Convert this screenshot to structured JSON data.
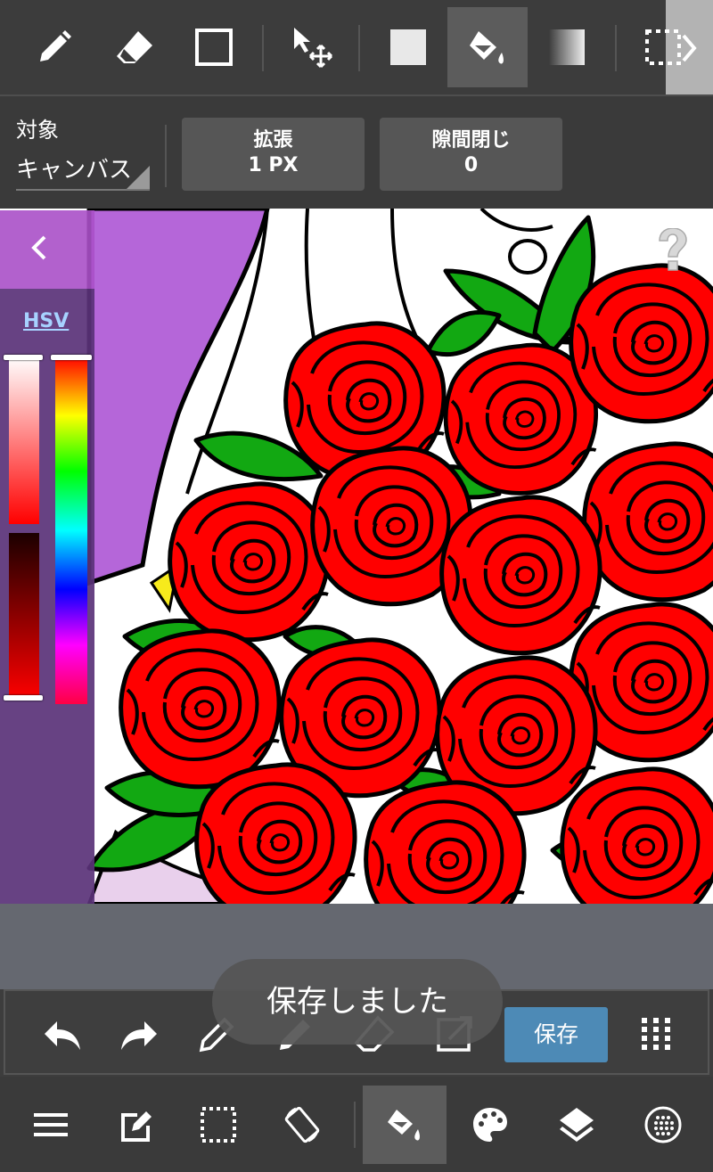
{
  "toolbar": {
    "tools": [
      {
        "name": "pen",
        "icon": "pencil-icon"
      },
      {
        "name": "eraser",
        "icon": "eraser-icon"
      },
      {
        "name": "shape",
        "icon": "square-outline-icon"
      },
      {
        "name": "move",
        "icon": "move-arrows-icon"
      },
      {
        "name": "fill-color",
        "icon": "filled-square-icon"
      },
      {
        "name": "bucket",
        "icon": "paint-bucket-icon",
        "selected": true
      },
      {
        "name": "gradient",
        "icon": "gradient-icon"
      },
      {
        "name": "select",
        "icon": "dashed-select-icon"
      }
    ],
    "more_icon": "chevron-right-icon"
  },
  "fill_options": {
    "target_label": "対象",
    "target_value": "キャンバス",
    "expand_label": "拡張",
    "expand_value": "1 PX",
    "gap_close_label": "隙間閉じ",
    "gap_close_value": "0"
  },
  "color_panel": {
    "mode_label": "HSV",
    "current_color": "#ff0000"
  },
  "action_bar": {
    "save_label": "保存",
    "icons": [
      "undo-icon",
      "redo-icon",
      "pencil-icon",
      "pen-icon",
      "eraser-icon",
      "transform-icon",
      "grid-dots-icon"
    ]
  },
  "toast": {
    "message": "保存しました"
  },
  "bottom_nav": {
    "items": [
      "menu-icon",
      "edit-icon",
      "selection-icon",
      "rotate-icon",
      "paint-bucket-icon",
      "palette-icon",
      "layers-icon",
      "brush-settings-icon"
    ],
    "selected": "paint-bucket-icon"
  },
  "colors": {
    "accent": "#4d8ab6",
    "rose": "#ff0000",
    "leaf": "#12a812",
    "panel_purple": "#aa50c8"
  }
}
